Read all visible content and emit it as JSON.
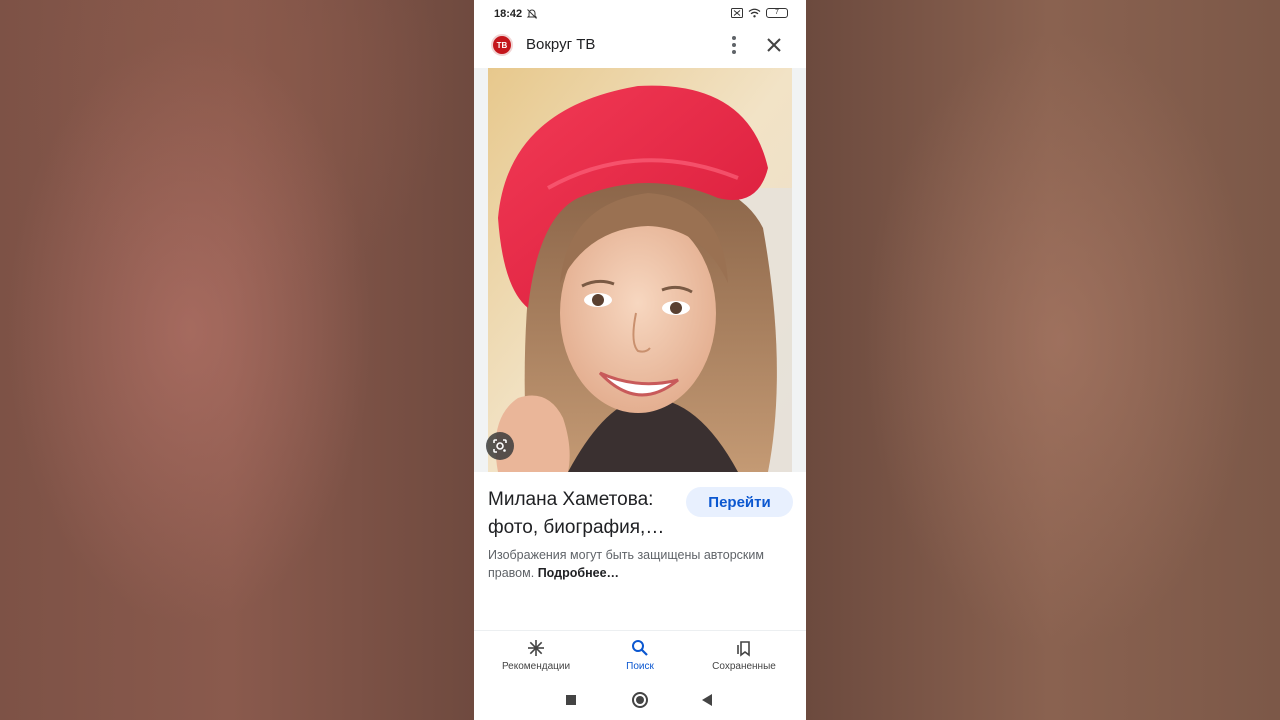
{
  "status_bar": {
    "time": "18:42",
    "battery": "7"
  },
  "header": {
    "site_icon_text": "ТВ",
    "site_name": "Вокруг ТВ"
  },
  "result": {
    "title": "Милана Хаметова: фото, биография,…",
    "action_label": "Перейти",
    "copyright_text": "Изображения могут быть защищены авторским правом.",
    "more_link": "Подробнее…"
  },
  "bottom_nav": {
    "items": [
      {
        "label": "Рекомендации",
        "icon": "asterisk-icon",
        "active": false
      },
      {
        "label": "Поиск",
        "icon": "search-icon",
        "active": true
      },
      {
        "label": "Сохраненные",
        "icon": "collections-icon",
        "active": false
      }
    ]
  },
  "colors": {
    "accent": "#0b57d0",
    "accent_bg": "#e8f0fe",
    "site_icon_red": "#c4161c",
    "beret_red": "#e8253f"
  }
}
